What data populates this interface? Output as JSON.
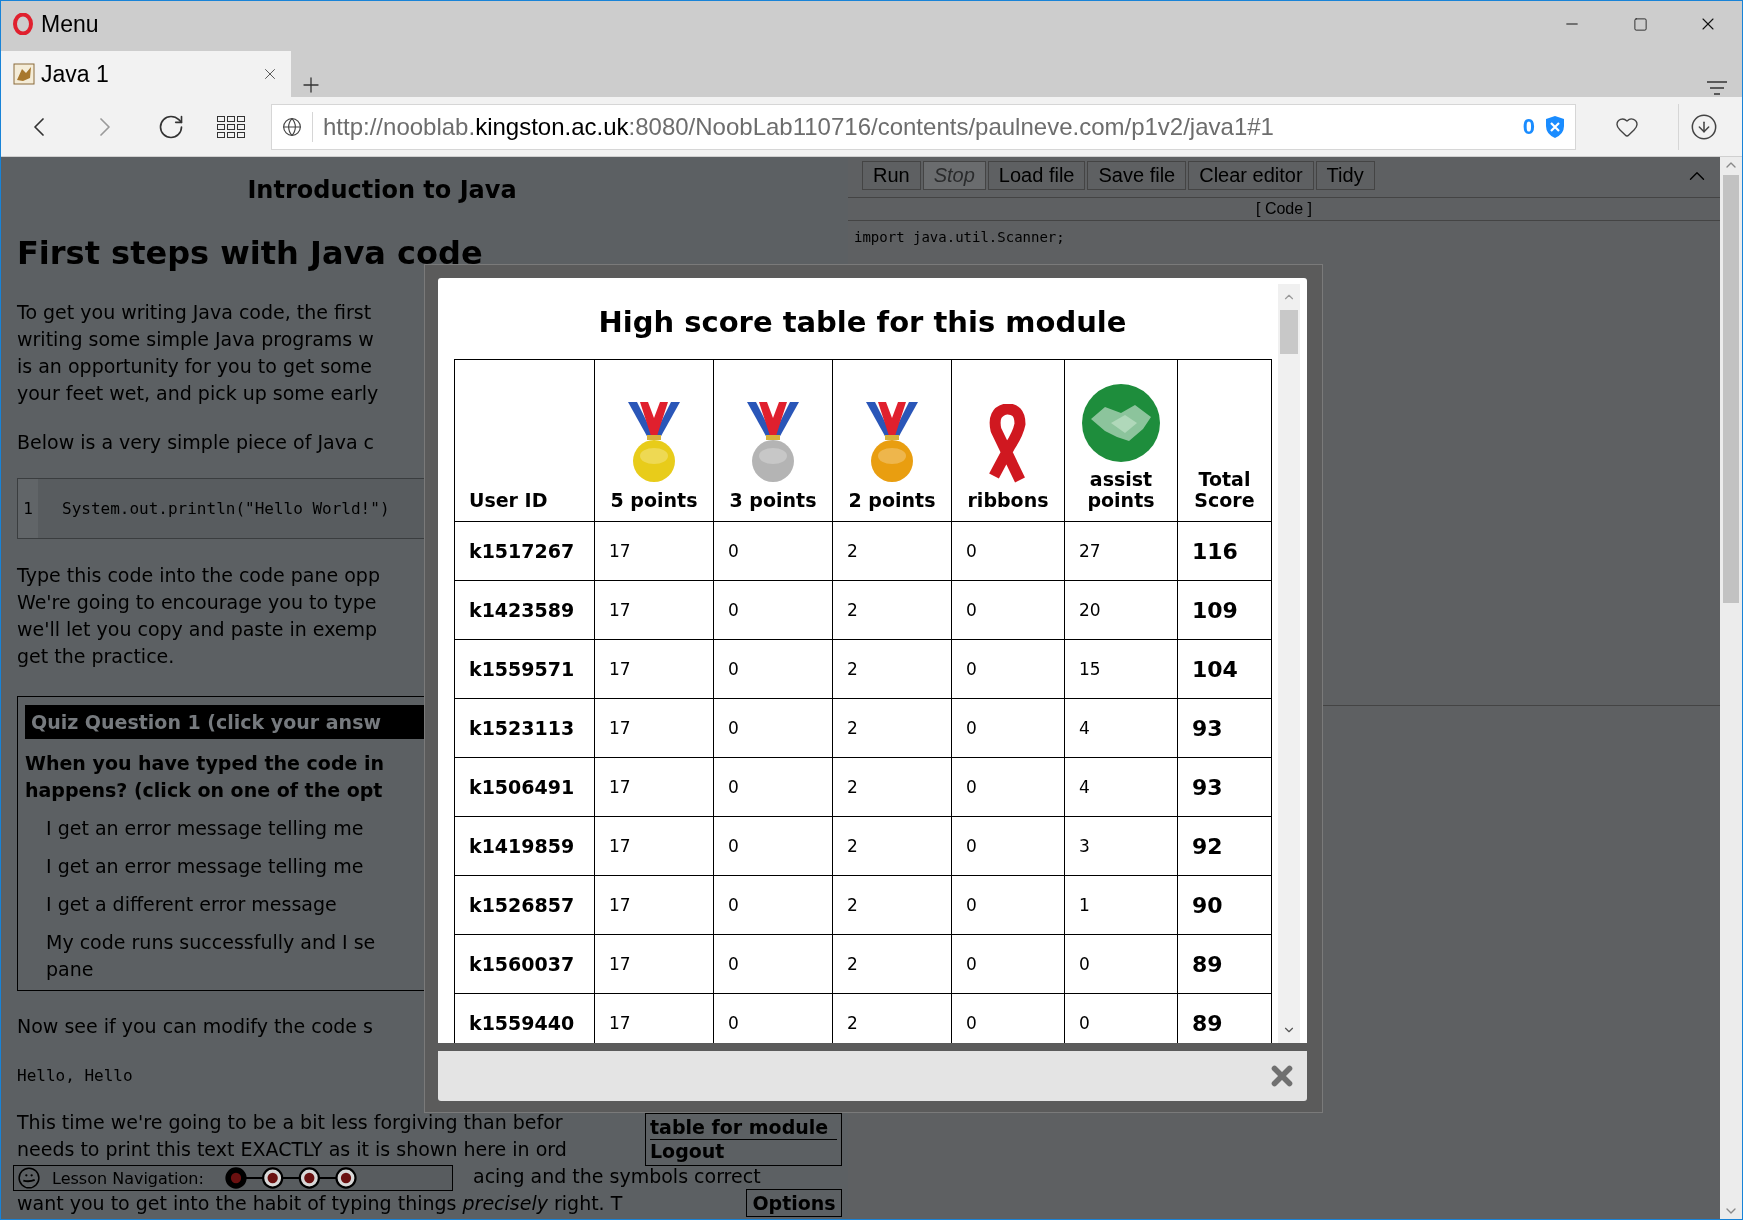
{
  "window": {
    "title": "Menu"
  },
  "tabs": [
    {
      "label": "Java 1",
      "selected": true
    }
  ],
  "toolbar": {
    "forward_disabled": true,
    "url": {
      "start": "http://nooblab.",
      "domain": "kingston.ac.uk",
      "end": ":8080/NoobLab110716/contents/paulneve.com/p1v2/java1#1"
    },
    "blocked_count": "0"
  },
  "lesson": {
    "header": "Introduction to Java",
    "heading": "First steps with Java code",
    "intro_lines": [
      "To get you writing Java code, the first",
      "writing some simple Java programs w",
      "is an opportunity for you to get some",
      "your feet wet, and pick up some early"
    ],
    "below_line": "Below is a very simple piece of Java c",
    "code_sample": {
      "line_number": "1",
      "code": "System.out.println(\"Hello World!\")"
    },
    "type_lines": [
      "Type this code into the code pane opp",
      "We're going to encourage you to type",
      "we'll let you copy and paste in exemp",
      "get the practice."
    ],
    "quiz": {
      "title": "Quiz Question 1 (click your answ",
      "question_lines": [
        "When you have typed the code in",
        "happens? (click on one of the opt"
      ],
      "options": [
        {
          "lines": [
            "I get an error message telling me"
          ]
        },
        {
          "lines": [
            "I get an error message telling me"
          ]
        },
        {
          "lines": [
            "I get a different error message"
          ]
        },
        {
          "lines": [
            "My code runs successfully and I se",
            "pane"
          ]
        }
      ]
    },
    "modify_line": "Now see if you can modify the code s",
    "expected_output": "Hello, Hello",
    "final_lines": [
      "This time we're going to be a bit less forgiving than befor",
      "needs to print this text EXACTLY as it is shown here in ord",
      "acing and the symbols correct",
      "want you to get into the habit of typing things *precisely* right. T"
    ]
  },
  "side_menu": {
    "links": [
      "table for module",
      "Logout"
    ],
    "options": "Options"
  },
  "lesson_navigation": {
    "label": "Lesson Navigation:",
    "steps": [
      {
        "selected": true
      },
      {
        "selected": false
      },
      {
        "selected": false
      },
      {
        "selected": false
      }
    ]
  },
  "code_pane": {
    "buttons": [
      {
        "label": "Run",
        "disabled": false
      },
      {
        "label": "Stop",
        "disabled": true
      },
      {
        "label": "Load file",
        "disabled": false
      },
      {
        "label": "Save file",
        "disabled": false
      },
      {
        "label": "Clear editor",
        "disabled": false
      },
      {
        "label": "Tidy",
        "disabled": false
      }
    ],
    "title": "[ Code ]",
    "code_lines": [
      "import java.util.Scanner;"
    ]
  },
  "modal": {
    "title": "High score table for this module",
    "columns": [
      {
        "label": "User ID"
      },
      {
        "label": "5 points",
        "kind": "medal",
        "color": "#e8cc1a"
      },
      {
        "label": "3 points",
        "kind": "medal",
        "color": "#b4b4b4"
      },
      {
        "label": "2 points",
        "kind": "medal",
        "color": "#e99e10"
      },
      {
        "label": "ribbons",
        "kind": "ribbon"
      },
      {
        "label": "assist points",
        "kind": "handshake"
      },
      {
        "label": "Total Score"
      }
    ],
    "rows": [
      [
        "k1517267",
        "17",
        "0",
        "2",
        "0",
        "27",
        "116"
      ],
      [
        "k1423589",
        "17",
        "0",
        "2",
        "0",
        "20",
        "109"
      ],
      [
        "k1559571",
        "17",
        "0",
        "2",
        "0",
        "15",
        "104"
      ],
      [
        "k1523113",
        "17",
        "0",
        "2",
        "0",
        "4",
        "93"
      ],
      [
        "k1506491",
        "17",
        "0",
        "2",
        "0",
        "4",
        "93"
      ],
      [
        "k1419859",
        "17",
        "0",
        "2",
        "0",
        "3",
        "92"
      ],
      [
        "k1526857",
        "17",
        "0",
        "2",
        "0",
        "1",
        "90"
      ],
      [
        "k1560037",
        "17",
        "0",
        "2",
        "0",
        "0",
        "89"
      ],
      [
        "k1559440",
        "17",
        "0",
        "2",
        "0",
        "0",
        "89"
      ]
    ]
  }
}
